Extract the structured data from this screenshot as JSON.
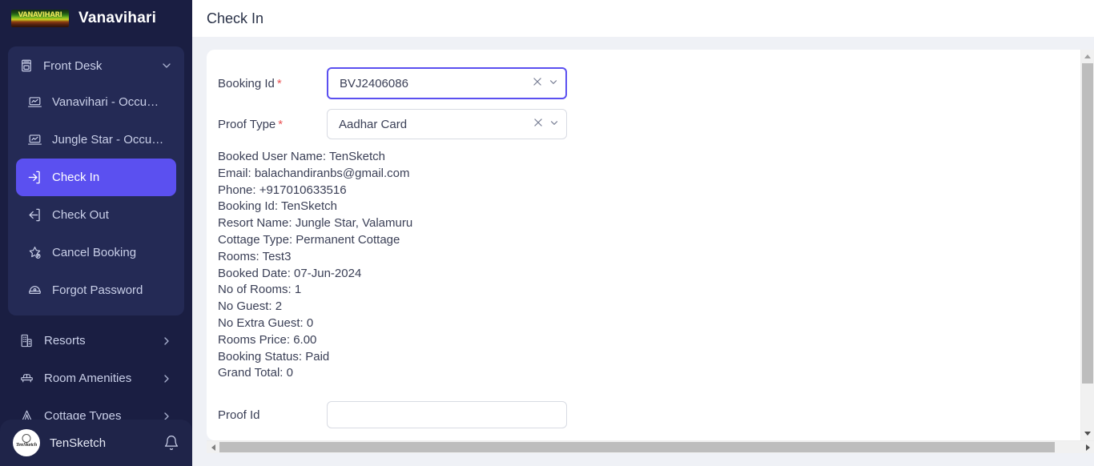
{
  "brand": {
    "logo_alt": "VANAVIHARI",
    "title": "Vanavihari"
  },
  "sidebar": {
    "group": {
      "icon": "front-desk-icon",
      "label": "Front Desk",
      "chevron": "chevron-down-icon",
      "items": [
        {
          "icon": "occupancy-chart-icon",
          "label": "Vanavihari - Occupan...",
          "active": false
        },
        {
          "icon": "occupancy-chart-icon",
          "label": "Jungle Star - Occupa...",
          "active": false
        },
        {
          "icon": "check-in-icon",
          "label": "Check In",
          "active": true
        },
        {
          "icon": "check-out-icon",
          "label": "Check Out",
          "active": false
        },
        {
          "icon": "cancel-booking-icon",
          "label": "Cancel Booking",
          "active": false
        },
        {
          "icon": "forgot-password-icon",
          "label": "Forgot Password",
          "active": false
        }
      ]
    },
    "roots": [
      {
        "icon": "resorts-icon",
        "label": "Resorts",
        "chevron": "chevron-right-icon"
      },
      {
        "icon": "room-amenities-icon",
        "label": "Room Amenities",
        "chevron": "chevron-right-icon"
      },
      {
        "icon": "cottage-types-icon",
        "label": "Cottage Types",
        "chevron": "chevron-right-icon"
      }
    ],
    "footer": {
      "avatar_label": "TenSketch",
      "name": "TenSketch",
      "bell": "notification-bell-icon"
    }
  },
  "header": {
    "title": "Check In"
  },
  "form": {
    "booking_id": {
      "label": "Booking Id",
      "required": "*",
      "value": "BVJ2406086",
      "clear_icon": "clear-icon",
      "dropdown_icon": "chevron-down-icon"
    },
    "proof_type": {
      "label": "Proof Type",
      "required": "*",
      "value": "Aadhar Card",
      "clear_icon": "clear-icon",
      "dropdown_icon": "chevron-down-icon"
    },
    "proof_id": {
      "label": "Proof Id",
      "value": "",
      "placeholder": ""
    }
  },
  "booking_details": [
    "Booked User Name: TenSketch",
    "Email: balachandiranbs@gmail.com",
    "Phone: +917010633516",
    "Booking Id: TenSketch",
    "Resort Name: Jungle Star, Valamuru",
    "Cottage Type: Permanent Cottage",
    "Rooms: Test3",
    "Booked Date: 07-Jun-2024",
    "No of Rooms: 1",
    "No Guest: 2",
    "No Extra Guest: 0",
    "Rooms Price: 6.00",
    "Booking Status: Paid",
    "Grand Total: 0"
  ],
  "scrollbars": {
    "vertical": {
      "up": "scroll-up-arrow",
      "down": "scroll-down-arrow"
    },
    "horizontal": {
      "left": "scroll-left-arrow",
      "right": "scroll-right-arrow"
    }
  },
  "colors": {
    "sidebar_bg": "#1a1e42",
    "sidebar_group_bg": "#242a55",
    "accent": "#5b50f0",
    "page_bg": "#eff1f6",
    "card_bg": "#ffffff",
    "required_star": "#ea5455",
    "text": "#3a3f56"
  }
}
